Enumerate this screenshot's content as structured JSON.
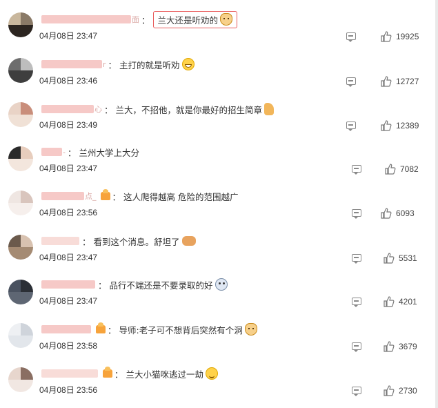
{
  "colors": {
    "highlight": "#e85a5a",
    "name_blur": "#f6c9c7",
    "icon_gray": "#888888"
  },
  "comments": [
    {
      "name_tail": "面",
      "badge": false,
      "text": "兰大还是听劝的",
      "emoji": "cat",
      "date": "04月08日 23:47",
      "likes": "19925",
      "highlighted": true
    },
    {
      "name_tail": "r",
      "badge": false,
      "text": "主打的就是听劝",
      "emoji": "grin",
      "date": "04月08日 23:46",
      "likes": "12727",
      "highlighted": false
    },
    {
      "name_tail": "心",
      "badge": false,
      "text": "兰大，不招他，就是你最好的招生简章",
      "emoji": "thumb",
      "date": "04月08日 23:49",
      "likes": "12389",
      "highlighted": false
    },
    {
      "name_tail": "-",
      "badge": false,
      "text": "兰州大学上大分",
      "emoji": "",
      "date": "04月08日 23:47",
      "likes": "7082",
      "highlighted": false
    },
    {
      "name_tail": "点_",
      "badge": true,
      "text": "这人爬得越高 危险的范围越广",
      "emoji": "",
      "date": "04月08日 23:56",
      "likes": "6093",
      "highlighted": false
    },
    {
      "name_tail": "",
      "badge": false,
      "text": "看到这个消息。舒坦了",
      "emoji": "hands",
      "date": "04月08日 23:47",
      "likes": "5531",
      "highlighted": false
    },
    {
      "name_tail": "",
      "badge": false,
      "text": "品行不端还是不要录取的好",
      "emoji": "cry",
      "date": "04月08日 23:47",
      "likes": "4201",
      "highlighted": false
    },
    {
      "name_tail": "",
      "badge": true,
      "text": "导师:老子可不想背后突然有个洞",
      "emoji": "cat",
      "date": "04月08日 23:58",
      "likes": "3679",
      "highlighted": false
    },
    {
      "name_tail": "",
      "badge": true,
      "text": "兰大小猫咪逃过一劫",
      "emoji": "face",
      "date": "04月08日 23:56",
      "likes": "2730",
      "highlighted": false
    }
  ]
}
